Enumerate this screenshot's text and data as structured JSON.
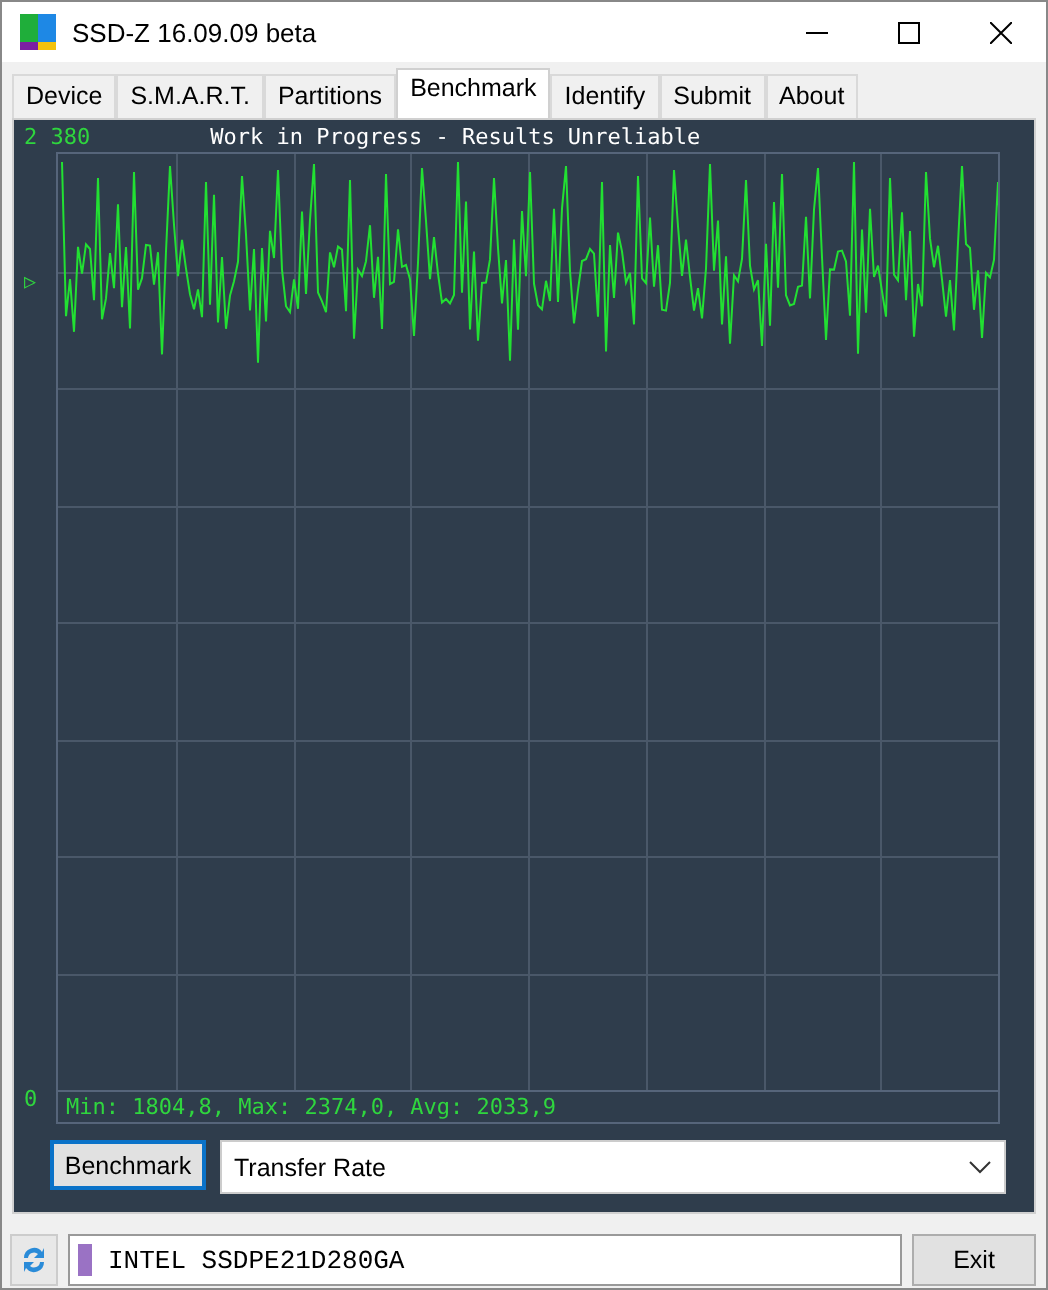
{
  "window": {
    "title": "SSD-Z 16.09.09 beta"
  },
  "tabs": [
    {
      "label": "Device",
      "selected": false
    },
    {
      "label": "S.M.A.R.T.",
      "selected": false
    },
    {
      "label": "Partitions",
      "selected": false
    },
    {
      "label": "Benchmark",
      "selected": true
    },
    {
      "label": "Identify",
      "selected": false
    },
    {
      "label": "Submit",
      "selected": false
    },
    {
      "label": "About",
      "selected": false
    }
  ],
  "graph": {
    "y_max_label": "2 380",
    "title": "Work in Progress - Results Unreliable",
    "y_min_label": "0",
    "marker": "▷",
    "stats": "Min: 1804,8, Max: 2374,0, Avg: 2033,9"
  },
  "controls": {
    "button": "Benchmark",
    "dropdown": "Transfer Rate"
  },
  "status_bar": {
    "drive": "INTEL SSDPE21D280GA",
    "exit_button": "Exit"
  }
}
